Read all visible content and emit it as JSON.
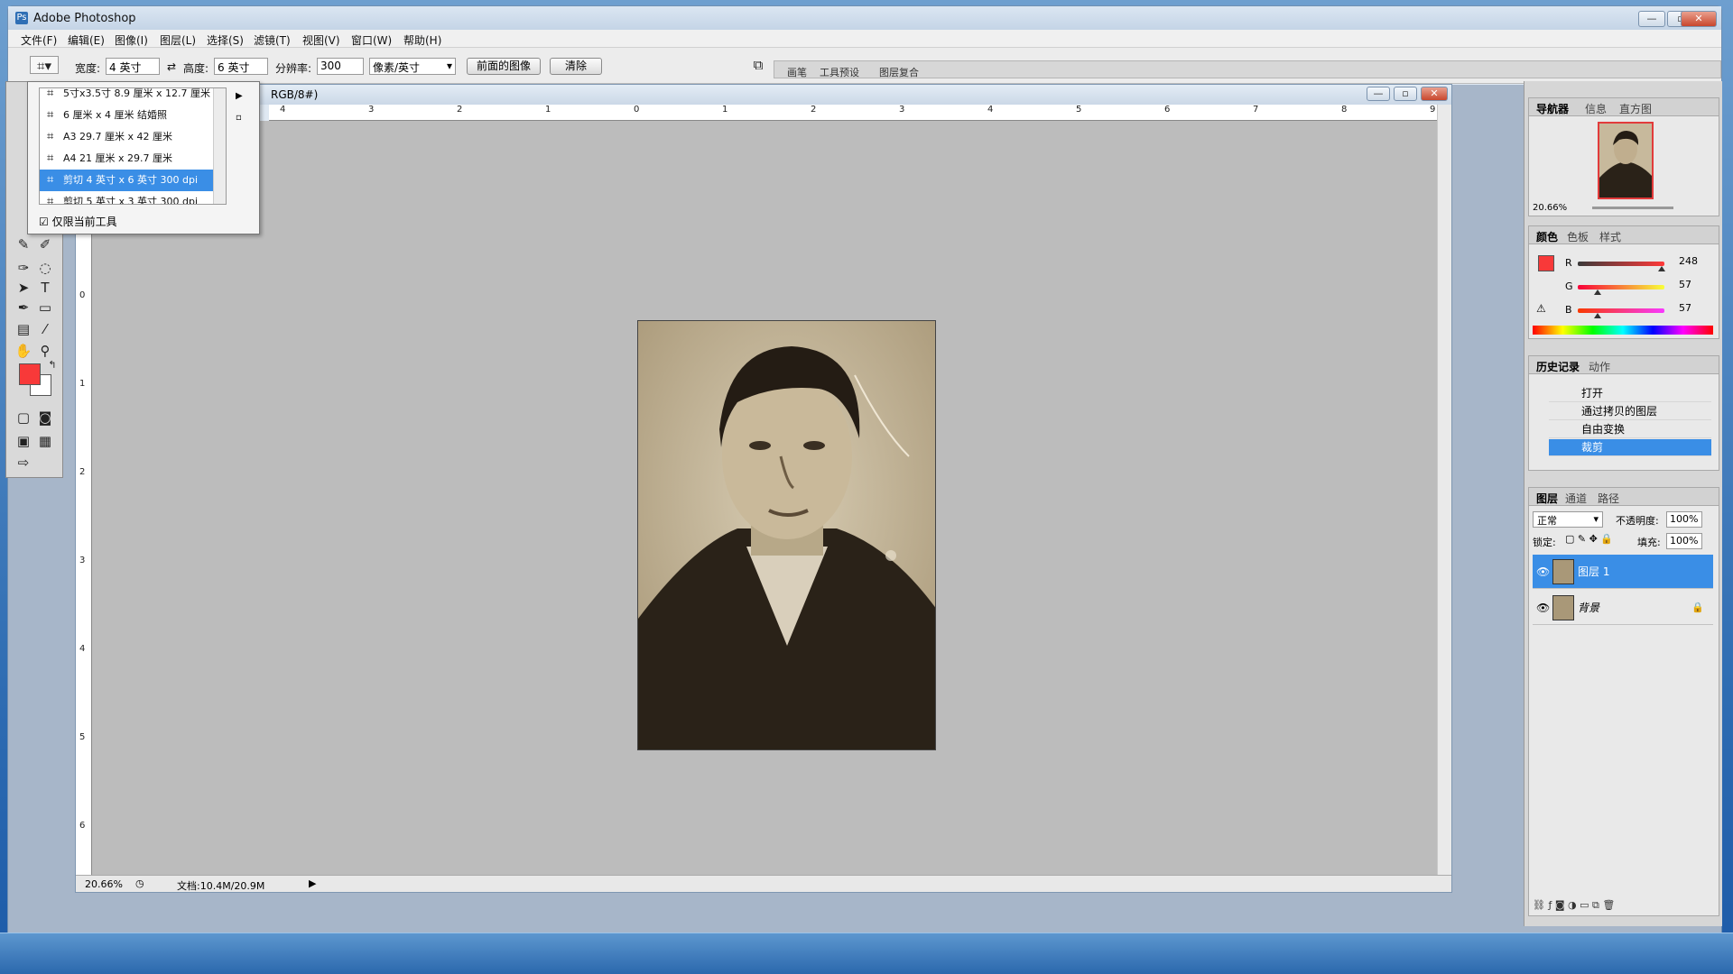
{
  "app": {
    "title": "Adobe Photoshop"
  },
  "window_controls": {
    "minimize": "—",
    "restore": "▫",
    "close": "✕"
  },
  "menu": [
    "文件(F)",
    "编辑(E)",
    "图像(I)",
    "图层(L)",
    "选择(S)",
    "滤镜(T)",
    "视图(V)",
    "窗口(W)",
    "帮助(H)"
  ],
  "options": {
    "width_label": "宽度:",
    "width_value": "4 英寸",
    "height_label": "高度:",
    "height_value": "6 英寸",
    "res_label": "分辨率:",
    "res_value": "300",
    "res_unit": "像素/英寸",
    "front_image": "前面的图像",
    "clear": "清除"
  },
  "palette_well": [
    "画笔",
    "工具预设",
    "图层复合"
  ],
  "preset_dropdown": {
    "items": [
      "5寸x3.5寸  8.9 厘米 x 12.7 厘米",
      "6 厘米 x 4 厘米 结婚照",
      "A3  29.7 厘米 x 42 厘米",
      "A4  21 厘米 x 29.7 厘米",
      "剪切 4 英寸 x 6 英寸 300 dpi",
      "剪切 5 英寸 x 3 英寸 300 dpi"
    ],
    "selected_index": 4,
    "checkbox_label": "仅限当前工具",
    "checkbox_checked": true
  },
  "document": {
    "title_suffix": "RGB/8#)",
    "zoom": "20.66%",
    "doc_info": "文档:10.4M/20.9M",
    "ruler_h": [
      "4",
      "3",
      "2",
      "1",
      "0",
      "1",
      "2",
      "3",
      "4",
      "5",
      "6",
      "7",
      "8",
      "9"
    ],
    "ruler_v": [
      "0",
      "1",
      "2",
      "3",
      "4",
      "5",
      "6"
    ]
  },
  "navigator": {
    "tabs": [
      "导航器",
      "信息",
      "直方图"
    ],
    "zoom": "20.66%"
  },
  "color_panel": {
    "tabs": [
      "颜色",
      "色板",
      "样式"
    ],
    "r_label": "R",
    "r_value": "248",
    "r_fraction": 0.973,
    "g_label": "G",
    "g_value": "57",
    "g_fraction": 0.224,
    "b_label": "B",
    "b_value": "57",
    "b_fraction": 0.224,
    "fg_color": "#f83939"
  },
  "history_panel": {
    "tabs": [
      "历史记录",
      "动作"
    ],
    "items": [
      "打开",
      "通过拷贝的图层",
      "自由变换",
      "裁剪"
    ],
    "selected_index": 3
  },
  "layers_panel": {
    "tabs": [
      "图层",
      "通道",
      "路径"
    ],
    "blend_mode": "正常",
    "opacity_label": "不透明度:",
    "opacity_value": "100%",
    "lock_label": "锁定:",
    "fill_label": "填充:",
    "fill_value": "100%",
    "layers": [
      "图层 1",
      "背景"
    ],
    "selected_index": 0
  }
}
